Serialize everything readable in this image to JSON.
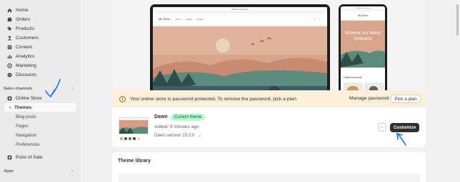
{
  "sidebar": {
    "items": [
      {
        "label": "Home",
        "icon": "home-icon"
      },
      {
        "label": "Orders",
        "icon": "orders-icon"
      },
      {
        "label": "Products",
        "icon": "tag-icon"
      },
      {
        "label": "Customers",
        "icon": "person-icon"
      },
      {
        "label": "Content",
        "icon": "content-icon"
      },
      {
        "label": "Analytics",
        "icon": "chart-icon"
      },
      {
        "label": "Marketing",
        "icon": "target-icon"
      },
      {
        "label": "Discounts",
        "icon": "discount-icon"
      }
    ],
    "sales_channels_label": "Sales channels",
    "online_store": {
      "label": "Online Store",
      "subitems": {
        "themes": "Themes",
        "blog_posts": "Blog posts",
        "pages": "Pages",
        "navigation": "Navigation",
        "preferences": "Preferences"
      }
    },
    "point_of_sale": "Point of Sale",
    "apps_label": "Apps",
    "chevron": "›"
  },
  "preview": {
    "desktop": {
      "announcement": "Welcome to our store",
      "brand": "My Store",
      "links": [
        "Home",
        "Catalog",
        "Contact"
      ]
    },
    "mobile": {
      "announcement": "Welcome to our store",
      "brand": "My Store",
      "hero_text": "Browse our latest products",
      "featured_label": "Featured products"
    }
  },
  "banner": {
    "text": "Your online store is password protected. To remove the password, pick a plan.",
    "manage_password": "Manage password",
    "pick_plan": "Pick a plan"
  },
  "current_theme": {
    "name": "Dawn",
    "badge": "Current theme",
    "added": "Added: 9 minutes ago",
    "version": "Dawn version 15.2.0",
    "version_chevron": "⌄",
    "more": "···",
    "customize": "Customize",
    "swatch_colors": [
      "#d89c83",
      "#6b4b3b",
      "#5a7c4f",
      "#2d4a5a",
      "#e8d7c0"
    ]
  },
  "library": {
    "title": "Theme library"
  },
  "colors": {
    "annotation_blue": "#1a73e8",
    "badge_green": "#b4fed2",
    "banner_bg": "#fcefd9"
  }
}
